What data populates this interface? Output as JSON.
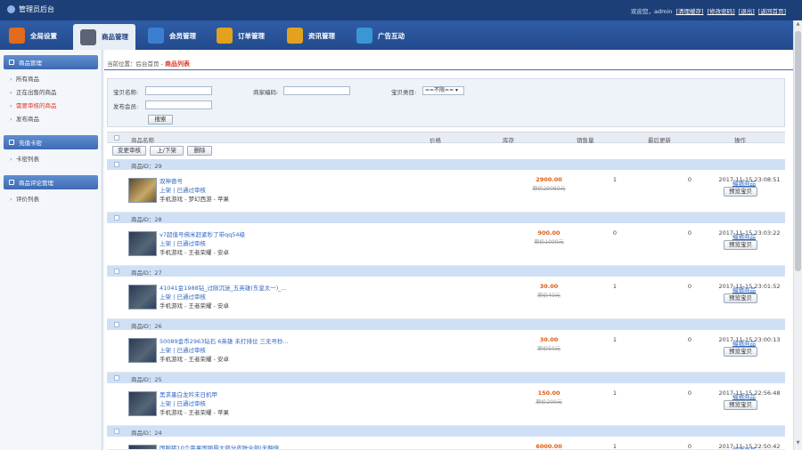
{
  "topbar": {
    "title": "管理员后台",
    "welcome": "欢迎您，admin",
    "links": [
      "[清理缓存]",
      "[修改密码]",
      "[退出]",
      "[返回首页]"
    ]
  },
  "nav": {
    "items": [
      "全局设置",
      "商品管理",
      "会员管理",
      "订单管理",
      "资讯管理",
      "广告互动"
    ],
    "icon_colors": [
      "#e36b1d",
      "#5a6474",
      "#3c7fd1",
      "#e3a21d",
      "#e3a21d",
      "#3a96d6"
    ]
  },
  "sidebar": {
    "sections": [
      {
        "title": "商品管理",
        "items": [
          "所有商品",
          "正在出售的商品",
          "需要审核的商品",
          "发布商品"
        ]
      },
      {
        "title": "充值卡密",
        "items": [
          "卡密列表"
        ]
      },
      {
        "title": "商品评论管理",
        "items": [
          "评价列表"
        ]
      }
    ]
  },
  "breadcrumb": {
    "prefix": "当前位置：后台首页 -",
    "current": "商品列表"
  },
  "search": {
    "name_label": "宝贝名称:",
    "code_label": "商家编码:",
    "category_label": "宝贝类目:",
    "category_value": "==不限==",
    "member_label": "发布会员:",
    "search_button": "搜索"
  },
  "table": {
    "headers": [
      "商品名称",
      "价格",
      "库存",
      "销售量",
      "最后更新",
      "操作"
    ],
    "actions": [
      "变更审核",
      "上/下架",
      "删除"
    ],
    "status_prefix": "上架",
    "status_sep": "|",
    "status_value": "已通过审核",
    "edit_label": "编辑商品",
    "preview_label": "预览宝贝",
    "rows": [
      {
        "id": "商品ID：29",
        "name": "双神兽号",
        "category": "手机游戏 - 梦幻西游 - 苹果",
        "price": "2900.00",
        "orig": "原价29060元",
        "stock": "1",
        "sales": "0",
        "updated": "2017-11-15 23:08:51"
      },
      {
        "id": "商品ID：28",
        "name": "v7超值号佛米赶紧秒了带qq54级",
        "category": "手机游戏 - 王者荣耀 - 安卓",
        "price": "900.00",
        "orig": "原价1000元",
        "stock": "0",
        "sales": "0",
        "updated": "2017-11-15 23:03:22"
      },
      {
        "id": "商品ID：27",
        "name": "41041金1988钻_过陨沉迷_五英雄(东皇太一)_...",
        "category": "手机游戏 - 王者荣耀 - 安卓",
        "price": "30.00",
        "orig": "原价40元",
        "stock": "1",
        "sales": "0",
        "updated": "2017-11-15 23:01:52"
      },
      {
        "id": "商品ID：26",
        "name": "50089金币2963钻石 6英雄 未打排位 三无号秒...",
        "category": "手机游戏 - 王者荣耀 - 安卓",
        "price": "30.00",
        "orig": "原价50元",
        "stock": "1",
        "sales": "0",
        "updated": "2017-11-15 23:00:13"
      },
      {
        "id": "商品ID：25",
        "name": "黑求墨白龙吟末日机甲",
        "category": "手机游戏 - 王者荣耀 - 苹果",
        "price": "150.00",
        "orig": "原价200元",
        "stock": "1",
        "sales": "0",
        "updated": "2017-11-15 22:56:48"
      },
      {
        "id": "商品ID：24",
        "name": "国服猪10个苹果国服最大部分皮肤全部(无翻倍",
        "category": "",
        "price": "6000.00",
        "orig": "",
        "stock": "1",
        "sales": "0",
        "updated": "2017-11-15 22:50:42"
      }
    ]
  }
}
